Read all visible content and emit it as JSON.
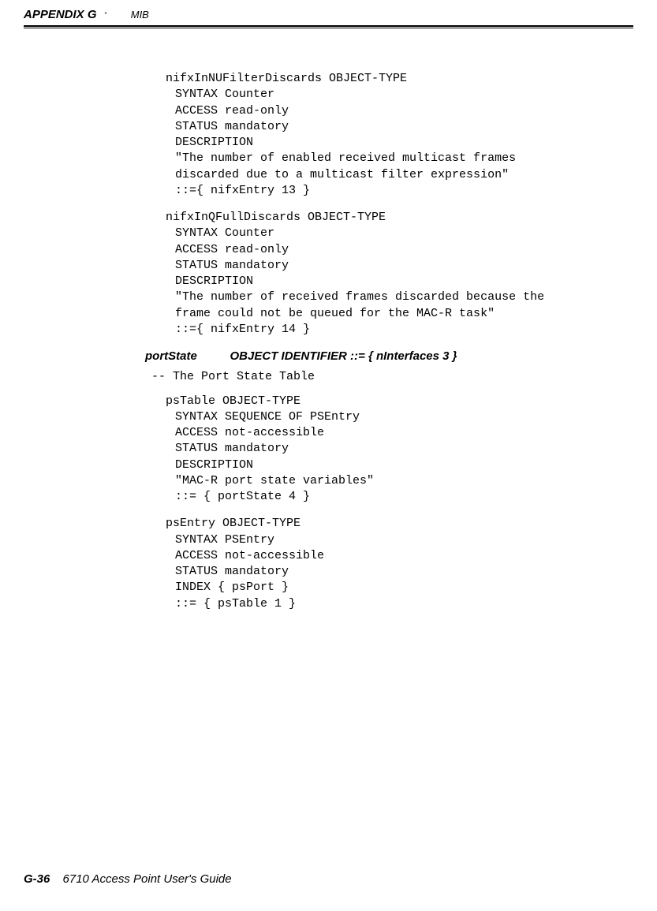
{
  "header": {
    "appendix": "APPENDIX G",
    "bullet": "\"",
    "sub": "MIB"
  },
  "block1": {
    "l1": "nifxInNUFilterDiscards OBJECT-TYPE",
    "l2": "SYNTAX Counter",
    "l3": "ACCESS read-only",
    "l4": "STATUS mandatory",
    "l5": "DESCRIPTION",
    "l6": "\"The number of enabled received multicast frames",
    "l7": "discarded due to a multicast filter expression\"",
    "l8": "::={ nifxEntry 13 }"
  },
  "block2": {
    "l1": "nifxInQFullDiscards    OBJECT-TYPE",
    "l2": "SYNTAX Counter",
    "l3": "ACCESS read-only",
    "l4": "STATUS mandatory",
    "l5": "DESCRIPTION",
    "l6": "\"The number of received frames discarded because the",
    "l7": "frame could not be queued for the MAC-R task\"",
    "l8": "::={ nifxEntry 14 }"
  },
  "section": {
    "heading": "portState          OBJECT IDENTIFIER ::= { nInterfaces 3 }",
    "comment": "-- The Port State Table"
  },
  "block3": {
    "l1": "psTable                OBJECT-TYPE",
    "l2": "SYNTAX SEQUENCE OF PSEntry",
    "l3": "ACCESS not-accessible",
    "l4": "STATUS mandatory",
    "l5": "DESCRIPTION",
    "l6": "\"MAC-R port state variables\"",
    "l7": "::= { portState 4 }"
  },
  "block4": {
    "l1": "psEntry                OBJECT-TYPE",
    "l2": "SYNTAX PSEntry",
    "l3": "ACCESS not-accessible",
    "l4": "STATUS mandatory",
    "l5": "INDEX { psPort }",
    "l6": "::= { psTable 1 }"
  },
  "footer": {
    "page": "G-36",
    "title": "6710 Access Point User's Guide"
  }
}
